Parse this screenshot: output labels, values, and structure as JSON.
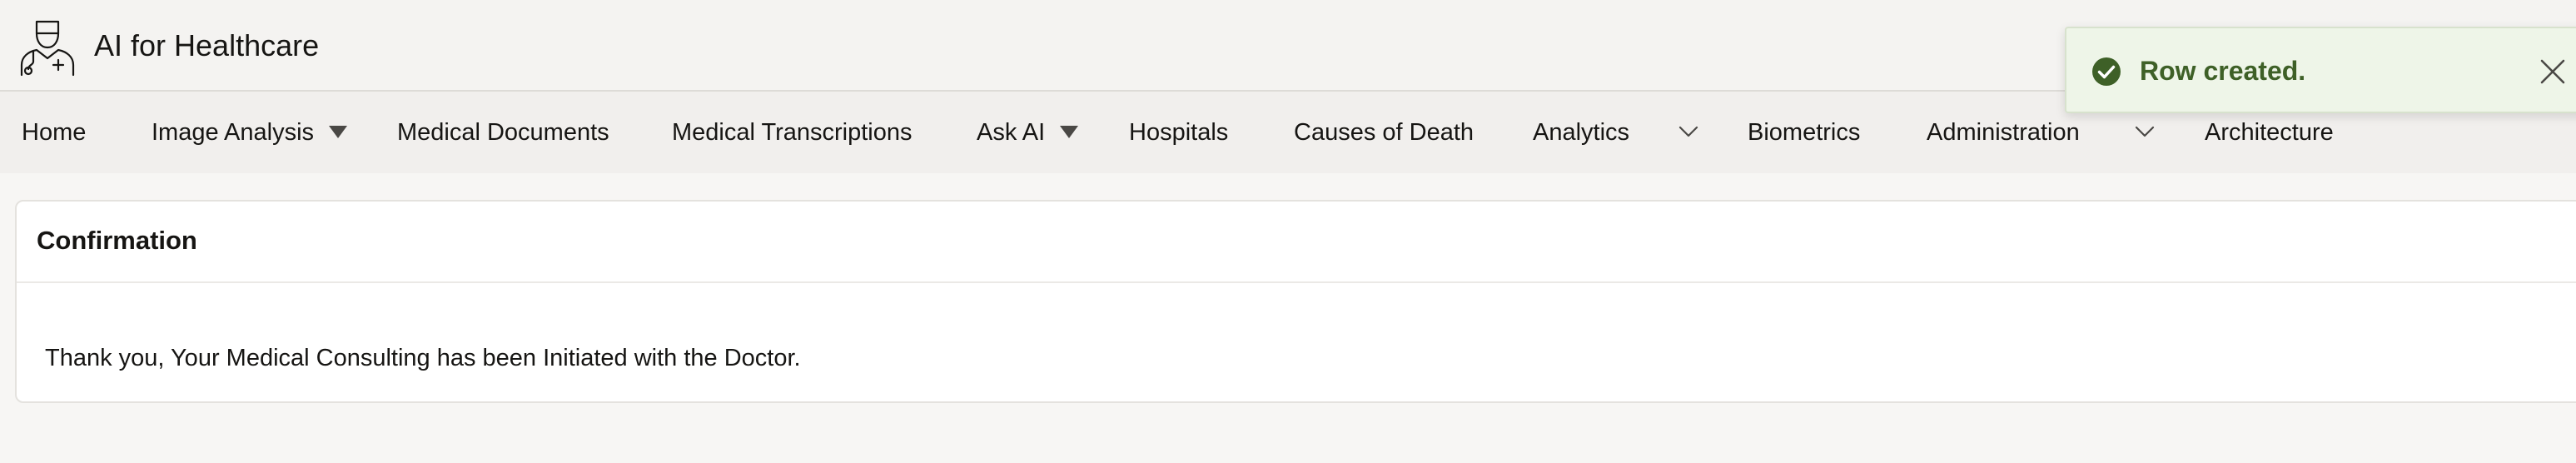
{
  "app": {
    "title": "AI for Healthcare",
    "logo_icon": "doctor-icon"
  },
  "nav": {
    "items": [
      {
        "label": "Home",
        "has_dropdown": false
      },
      {
        "label": "Image Analysis",
        "has_dropdown": true,
        "caret": "triangle-down-icon"
      },
      {
        "label": "Medical Documents",
        "has_dropdown": false
      },
      {
        "label": "Medical Transcriptions",
        "has_dropdown": false
      },
      {
        "label": "Ask AI",
        "has_dropdown": true,
        "caret": "triangle-down-icon"
      },
      {
        "label": "Hospitals",
        "has_dropdown": false
      },
      {
        "label": "Causes of Death",
        "has_dropdown": false
      },
      {
        "label": "Analytics",
        "has_dropdown": true,
        "caret": "chevron-down-icon"
      },
      {
        "label": "Biometrics",
        "has_dropdown": false
      },
      {
        "label": "Administration",
        "has_dropdown": true,
        "caret": "chevron-down-icon"
      },
      {
        "label": "Architecture",
        "has_dropdown": false
      }
    ]
  },
  "region": {
    "title": "Confirmation",
    "message": "Thank you, Your Medical Consulting has been Initiated with the Doctor."
  },
  "toast": {
    "message": "Row created.",
    "status": "success",
    "icon": "check-circle-icon",
    "close_icon": "close-icon"
  },
  "colors": {
    "header_bg": "#f4f3f1",
    "nav_bg": "#f1efed",
    "page_bg": "#f7f6f4",
    "toast_bg": "#eef5e8",
    "toast_text": "#3e6027",
    "text": "#161513"
  }
}
